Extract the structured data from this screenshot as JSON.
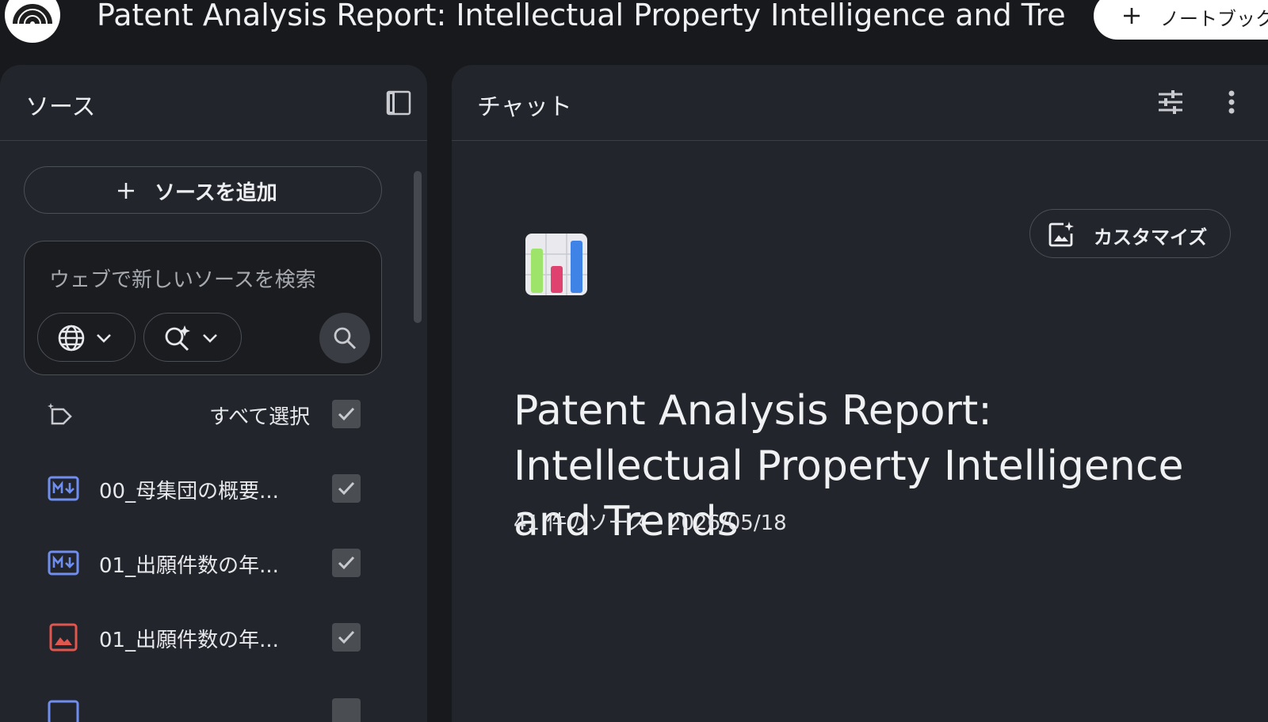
{
  "app": {
    "notebook_title": "Patent Analysis Report: Intellectual Property Intelligence and Trends",
    "new_notebook_label": "ノートブック"
  },
  "sources": {
    "title": "ソース",
    "add_label": "ソースを追加",
    "search_placeholder": "ウェブで新しいソースを検索",
    "select_all_label": "すべて選択",
    "items": [
      {
        "name": "00_母集団の概要...",
        "type": "markdown",
        "checked": true
      },
      {
        "name": "01_出願件数の年...",
        "type": "markdown",
        "checked": true
      },
      {
        "name": "01_出願件数の年...",
        "type": "image",
        "checked": true
      },
      {
        "name": "",
        "type": "markdown",
        "checked": true
      }
    ]
  },
  "chat": {
    "title": "チャット",
    "customize_label": "カスタマイズ",
    "notebook_icon": "bar-chart-emoji",
    "meta": "41 件のソース · 2026/05/18"
  },
  "colors": {
    "background": "#17191d",
    "panel": "#22252b",
    "markdown_icon": "#6f8ef0",
    "image_icon": "#e0574f"
  }
}
